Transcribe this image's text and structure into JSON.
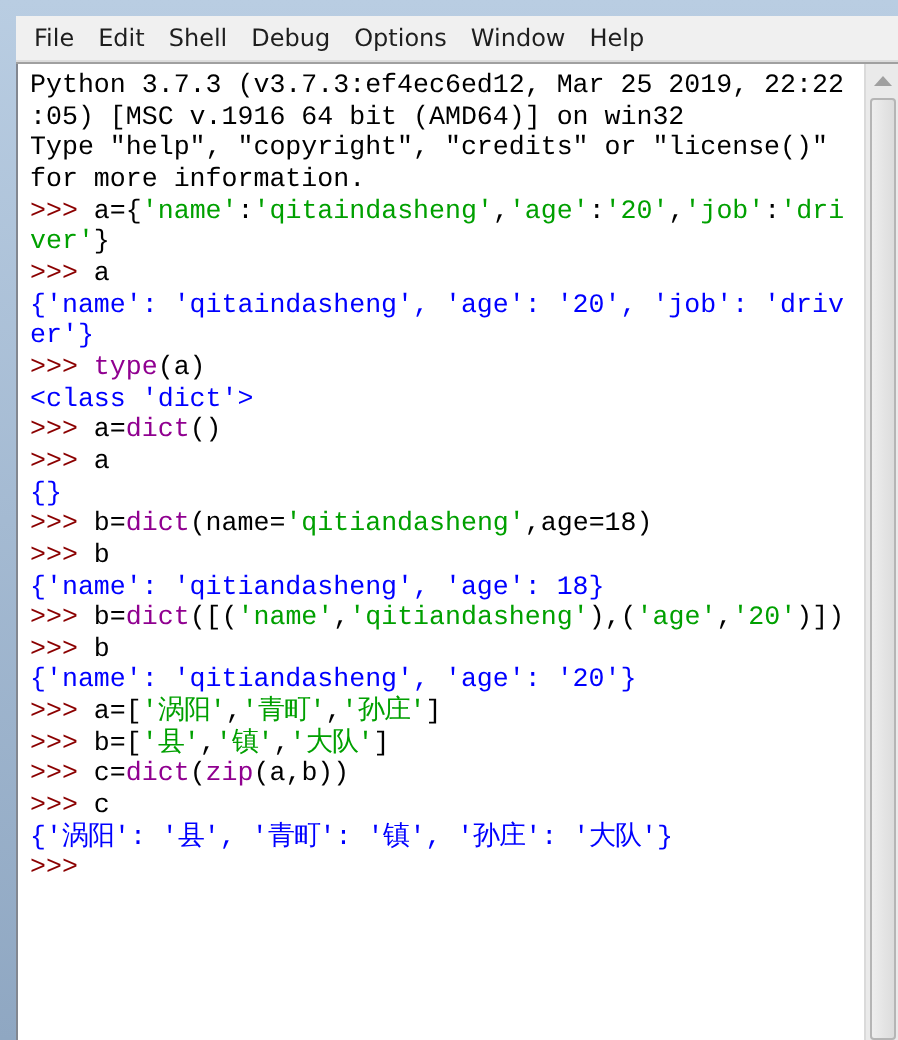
{
  "menu": [
    {
      "label": "File"
    },
    {
      "label": "Edit"
    },
    {
      "label": "Shell"
    },
    {
      "label": "Debug"
    },
    {
      "label": "Options"
    },
    {
      "label": "Window"
    },
    {
      "label": "Help"
    }
  ],
  "shell_lines": [
    [
      {
        "kind": "plain",
        "text": "Python 3.7.3 (v3.7.3:ef4ec6ed12, Mar 25 2019, 22:22"
      }
    ],
    [
      {
        "kind": "plain",
        "text": ":05) [MSC v.1916 64 bit (AMD64)] on win32"
      }
    ],
    [
      {
        "kind": "plain",
        "text": "Type \"help\", \"copyright\", \"credits\" or \"license()\""
      }
    ],
    [
      {
        "kind": "plain",
        "text": "for more information."
      }
    ],
    [
      {
        "kind": "prompt",
        "text": ">>> "
      },
      {
        "kind": "plain",
        "text": "a={"
      },
      {
        "kind": "string",
        "text": "'name'"
      },
      {
        "kind": "plain",
        "text": ":"
      },
      {
        "kind": "string",
        "text": "'qitaindasheng'"
      },
      {
        "kind": "plain",
        "text": ","
      },
      {
        "kind": "string",
        "text": "'age'"
      },
      {
        "kind": "plain",
        "text": ":"
      },
      {
        "kind": "string",
        "text": "'20'"
      },
      {
        "kind": "plain",
        "text": ","
      },
      {
        "kind": "string",
        "text": "'job'"
      },
      {
        "kind": "plain",
        "text": ":"
      },
      {
        "kind": "string",
        "text": "'dri"
      }
    ],
    [
      {
        "kind": "string",
        "text": "ver'"
      },
      {
        "kind": "plain",
        "text": "}"
      }
    ],
    [
      {
        "kind": "prompt",
        "text": ">>> "
      },
      {
        "kind": "plain",
        "text": "a"
      }
    ],
    [
      {
        "kind": "output",
        "text": "{'name': 'qitaindasheng', 'age': '20', 'job': 'driv"
      }
    ],
    [
      {
        "kind": "output",
        "text": "er'}"
      }
    ],
    [
      {
        "kind": "prompt",
        "text": ">>> "
      },
      {
        "kind": "builtin",
        "text": "type"
      },
      {
        "kind": "plain",
        "text": "(a)"
      }
    ],
    [
      {
        "kind": "output",
        "text": "<class 'dict'>"
      }
    ],
    [
      {
        "kind": "prompt",
        "text": ">>> "
      },
      {
        "kind": "plain",
        "text": "a="
      },
      {
        "kind": "builtin",
        "text": "dict"
      },
      {
        "kind": "plain",
        "text": "()"
      }
    ],
    [
      {
        "kind": "prompt",
        "text": ">>> "
      },
      {
        "kind": "plain",
        "text": "a"
      }
    ],
    [
      {
        "kind": "output",
        "text": "{}"
      }
    ],
    [
      {
        "kind": "prompt",
        "text": ">>> "
      },
      {
        "kind": "plain",
        "text": "b="
      },
      {
        "kind": "builtin",
        "text": "dict"
      },
      {
        "kind": "plain",
        "text": "(name="
      },
      {
        "kind": "string",
        "text": "'qitiandasheng'"
      },
      {
        "kind": "plain",
        "text": ",age=18)"
      }
    ],
    [
      {
        "kind": "prompt",
        "text": ">>> "
      },
      {
        "kind": "plain",
        "text": "b"
      }
    ],
    [
      {
        "kind": "output",
        "text": "{'name': 'qitiandasheng', 'age': 18}"
      }
    ],
    [
      {
        "kind": "prompt",
        "text": ">>> "
      },
      {
        "kind": "plain",
        "text": "b="
      },
      {
        "kind": "builtin",
        "text": "dict"
      },
      {
        "kind": "plain",
        "text": "([("
      },
      {
        "kind": "string",
        "text": "'name'"
      },
      {
        "kind": "plain",
        "text": ","
      },
      {
        "kind": "string",
        "text": "'qitiandasheng'"
      },
      {
        "kind": "plain",
        "text": "),("
      },
      {
        "kind": "string",
        "text": "'age'"
      },
      {
        "kind": "plain",
        "text": ","
      },
      {
        "kind": "string",
        "text": "'20'"
      },
      {
        "kind": "plain",
        "text": ")])"
      }
    ],
    [
      {
        "kind": "prompt",
        "text": ">>> "
      },
      {
        "kind": "plain",
        "text": "b"
      }
    ],
    [
      {
        "kind": "output",
        "text": "{'name': 'qitiandasheng', 'age': '20'}"
      }
    ],
    [
      {
        "kind": "prompt",
        "text": ">>> "
      },
      {
        "kind": "plain",
        "text": "a=["
      },
      {
        "kind": "string",
        "text": "'涡阳'"
      },
      {
        "kind": "plain",
        "text": ","
      },
      {
        "kind": "string",
        "text": "'青町'"
      },
      {
        "kind": "plain",
        "text": ","
      },
      {
        "kind": "string",
        "text": "'孙庄'"
      },
      {
        "kind": "plain",
        "text": "]"
      }
    ],
    [
      {
        "kind": "prompt",
        "text": ">>> "
      },
      {
        "kind": "plain",
        "text": "b=["
      },
      {
        "kind": "string",
        "text": "'县'"
      },
      {
        "kind": "plain",
        "text": ","
      },
      {
        "kind": "string",
        "text": "'镇'"
      },
      {
        "kind": "plain",
        "text": ","
      },
      {
        "kind": "string",
        "text": "'大队'"
      },
      {
        "kind": "plain",
        "text": "]"
      }
    ],
    [
      {
        "kind": "prompt",
        "text": ">>> "
      },
      {
        "kind": "plain",
        "text": "c="
      },
      {
        "kind": "builtin",
        "text": "dict"
      },
      {
        "kind": "plain",
        "text": "("
      },
      {
        "kind": "builtin",
        "text": "zip"
      },
      {
        "kind": "plain",
        "text": "(a,b))"
      }
    ],
    [
      {
        "kind": "prompt",
        "text": ">>> "
      },
      {
        "kind": "plain",
        "text": "c"
      }
    ],
    [
      {
        "kind": "output",
        "text": "{'涡阳': '县', '青町': '镇', '孙庄': '大队'}"
      }
    ],
    [
      {
        "kind": "prompt",
        "text": ">>>"
      }
    ]
  ]
}
